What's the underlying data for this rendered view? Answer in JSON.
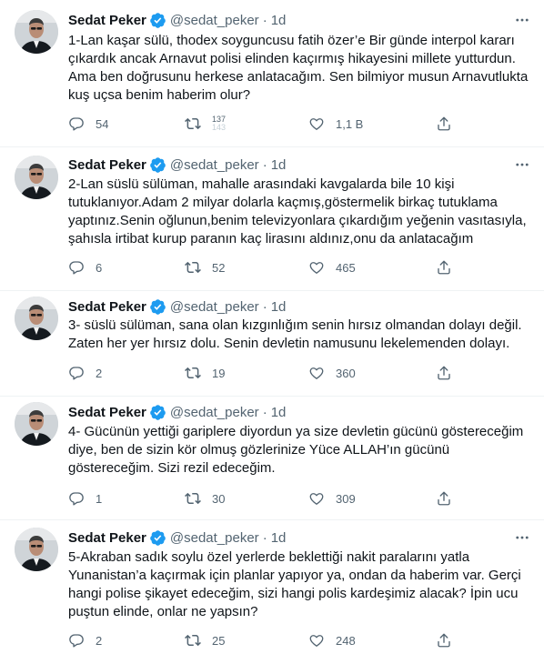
{
  "tweets": [
    {
      "name": "Sedat Peker",
      "handle": "@sedat_peker",
      "dot": "·",
      "time": "1d",
      "text": "1-Lan kaşar sülü, thodex soyguncusu fatih özer’e Bir günde interpol kararı çıkardık ancak Arnavut polisi elinden kaçırmış hikayesini millete yutturdun. Ama ben doğrusunu herkese anlatacağım. Sen bilmiyor musun Arnavutlukta kuş uçsa benim haberim olur?",
      "replies": "54",
      "retweets_top": "137",
      "retweets_bottom": "143",
      "likes": "1,1 B"
    },
    {
      "name": "Sedat Peker",
      "handle": "@sedat_peker",
      "dot": "·",
      "time": "1d",
      "text": "2-Lan süslü sülüman, mahalle arasındaki kavgalarda bile 10 kişi tutuklanıyor.Adam 2 milyar dolarla kaçmış,göstermelik birkaç tutuklama yaptınız.Senin oğlunun,benim televizyonlara çıkardığım yeğenin vasıtasıyla, şahısla irtibat kurup paranın kaç lirasını aldınız,onu da anlatacağım",
      "replies": "6",
      "retweets": "52",
      "likes": "465"
    },
    {
      "name": "Sedat Peker",
      "handle": "@sedat_peker",
      "dot": "·",
      "time": "1d",
      "text": "3- süslü sülüman, sana olan kızgınlığım senin hırsız olmandan dolayı değil. Zaten her yer hırsız dolu. Senin devletin namusunu lekelemenden dolayı.",
      "replies": "2",
      "retweets": "19",
      "likes": "360"
    },
    {
      "name": "Sedat Peker",
      "handle": "@sedat_peker",
      "dot": "·",
      "time": "1d",
      "text": "4- Gücünün yettiği gariplere diyordun ya size devletin gücünü göstereceğim diye, ben de sizin kör olmuş gözlerinize Yüce ALLAH’ın gücünü göstereceğim. Sizi rezil edeceğim.",
      "replies": "1",
      "retweets": "30",
      "likes": "309"
    },
    {
      "name": "Sedat Peker",
      "handle": "@sedat_peker",
      "dot": "·",
      "time": "1d",
      "text": "5-Akraban sadık soylu özel yerlerde beklettiği nakit paralarını yatla Yunanistan’a kaçırmak için planlar yapıyor ya, ondan da haberim var. Gerçi hangi polise şikayet edeceğim, sizi hangi polis kardeşimiz alacak? İpin ucu puştun elinde, onlar ne yapsın?",
      "replies": "2",
      "retweets": "25",
      "likes": "248"
    }
  ],
  "icons": {
    "verified": "verified-badge-icon",
    "more": "more-horizontal-icon",
    "reply": "reply-icon",
    "retweet": "retweet-icon",
    "like": "heart-icon",
    "share": "share-icon"
  },
  "colors": {
    "verified": "#1d9bf0",
    "text": "#0f1419",
    "secondary": "#536471",
    "divider": "#eff3f4"
  }
}
